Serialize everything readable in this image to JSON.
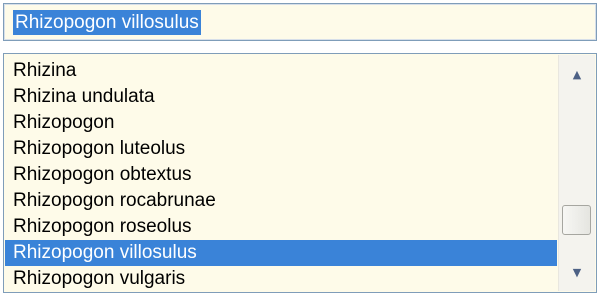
{
  "combo": {
    "value": "Rhizopogon villosulus"
  },
  "list": {
    "items": [
      "Rhizina",
      "Rhizina undulata",
      "Rhizopogon",
      "Rhizopogon luteolus",
      "Rhizopogon obtextus",
      "Rhizopogon rocabrunae",
      "Rhizopogon roseolus",
      "Rhizopogon villosulus",
      "Rhizopogon vulgaris"
    ],
    "selected_index": 7
  },
  "scrollbar": {
    "up_icon": "▲",
    "down_icon": "▼"
  },
  "colors": {
    "selection": "#3a83d8",
    "background": "#fefbe9",
    "border": "#7f9db9"
  }
}
